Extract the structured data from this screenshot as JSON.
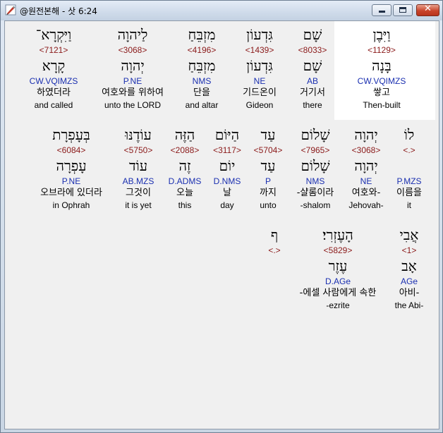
{
  "window": {
    "title": "@원전본해 - 삿 6:24",
    "controls": {
      "minimize": "minimize",
      "maximize": "maximize",
      "close": "✕"
    },
    "icons": {
      "app": "pen-icon"
    }
  },
  "rows": [
    {
      "words": [
        {
          "heb": "וַיִּקְרָא־",
          "num": "<7121>",
          "heb2": "קָרָא",
          "parse": "CW.VQIMZS",
          "ko": "하였더라",
          "en": "and called"
        },
        {
          "heb": "לַיהוָה",
          "num": "<3068>",
          "heb2": "יְהוָה",
          "parse": "P.NE",
          "ko": "여호와를 위하여",
          "en": "unto the LORD"
        },
        {
          "heb": "מִזְבֵּחַ",
          "num": "<4196>",
          "heb2": "מִזְבֵּחַ",
          "parse": "NMS",
          "ko": "단을",
          "en": "and altar"
        },
        {
          "heb": "גִּדְעוֹן",
          "num": "<1439>",
          "heb2": "גִּדְעוֹן",
          "parse": "NE",
          "ko": "기드온이",
          "en": "Gideon"
        },
        {
          "heb": "שָׁם",
          "num": "<8033>",
          "heb2": "שָׁם",
          "parse": "AB",
          "ko": "거기서",
          "en": "there"
        },
        {
          "heb": "וַיִּבֶן",
          "num": "<1129>",
          "heb2": "בָּנָה",
          "parse": "CW.VQIMZS",
          "ko": "쌓고",
          "en": "Then-built"
        }
      ]
    },
    {
      "words": [
        {
          "heb": "בְּעָפְרָת",
          "num": "<6084>",
          "heb2": "עָפְרָה",
          "parse": "P.NE",
          "ko": "오브라에 있더라",
          "en": "in Ophrah"
        },
        {
          "heb": "עוֹדֶנּוּ",
          "num": "<5750>",
          "heb2": "עוֹד",
          "parse": "AB.MZS",
          "ko": "그것이",
          "en": "it is yet"
        },
        {
          "heb": "הַזֶּה",
          "num": "<2088>",
          "heb2": "זֶה",
          "parse": "D.ADMS",
          "ko": "오늘",
          "en": "this"
        },
        {
          "heb": "הַיּוֹם",
          "num": "<3117>",
          "heb2": "יוֹם",
          "parse": "D.NMS",
          "ko": "날",
          "en": "day"
        },
        {
          "heb": "עַד",
          "num": "<5704>",
          "heb2": "עַד",
          "parse": "P",
          "ko": "까지",
          "en": "unto"
        },
        {
          "heb": "שָׁלוֹם",
          "num": "<7965>",
          "heb2": "שָׁלוֹם",
          "parse": "NMS",
          "ko": "-샬롬이라",
          "en": "-shalom"
        },
        {
          "heb": "יְהוָה",
          "num": "<3068>",
          "heb2": "יְהוָה",
          "parse": "NE",
          "ko": "여호와-",
          "en": "Jehovah-"
        },
        {
          "heb": "לוֹ",
          "num": "<.>",
          "heb2": "",
          "parse": "P.MZS",
          "ko": "이름을",
          "en": "it"
        }
      ]
    },
    {
      "words": [
        {
          "heb": "ף",
          "num": "<.>",
          "heb2": "",
          "parse": "",
          "ko": "",
          "en": ""
        },
        {
          "heb": "הָעֶזְרִי׃",
          "num": "<5829>",
          "heb2": "עֶזֶר",
          "parse": "D.AGe",
          "ko": "-에셀 사람에게 속한",
          "en": "-ezrite"
        },
        {
          "heb": "אֲבִי",
          "num": "<1>",
          "heb2": "אָב",
          "parse": "AGe",
          "ko": "아비-",
          "en": "the Abi-"
        }
      ]
    }
  ]
}
